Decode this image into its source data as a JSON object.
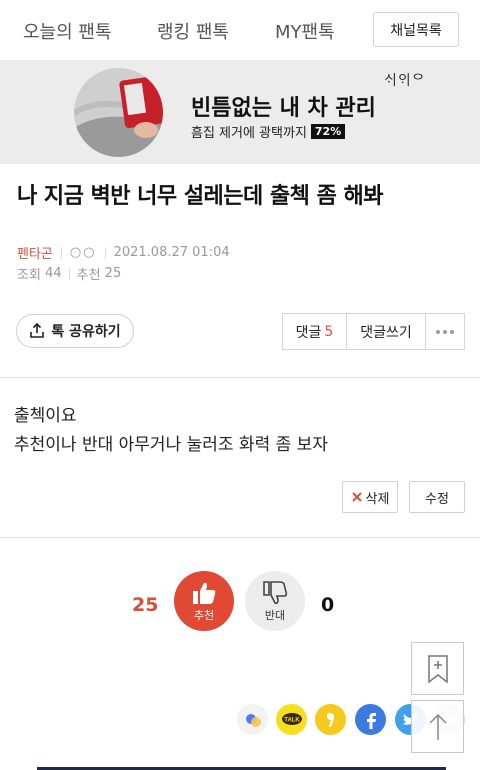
{
  "nav": {
    "tabs": [
      "오늘의 팬톡",
      "랭킹 팬톡",
      "MY팬톡"
    ],
    "channel_list_label": "채널목록"
  },
  "ad": {
    "brand": "ᄉᆡᄋᆡᄋ",
    "headline": "빈틈없는 내 차 관리",
    "sub": "흠집 제거에 광택까지",
    "badge": "72%"
  },
  "post": {
    "title": "나 지금 벽반 너무 설레는데 출첵 좀 해봐",
    "author": "펜타곤",
    "author_extra": "○○",
    "datetime": "2021.08.27 01:04",
    "views_label": "조회",
    "views": "44",
    "recommend_label": "추천",
    "recommend": "25",
    "body_lines": [
      "출첵이요",
      "추천이나 반대 아무거나 눌러조 화력 좀 보자"
    ]
  },
  "actions": {
    "share_label": "톡 공유하기",
    "comment_label": "댓글",
    "comment_count": "5",
    "write_comment_label": "댓글쓰기",
    "delete_label": "삭제",
    "edit_label": "수정"
  },
  "votes": {
    "up_count": "25",
    "up_label": "추천",
    "down_label": "반대",
    "down_count": "0"
  },
  "share_icons": [
    "dot-icon",
    "kakaotalk-icon",
    "kakaostory-icon",
    "facebook-icon",
    "twitter-icon",
    "link-icon"
  ],
  "colors": {
    "accent": "#d94f3b",
    "kakao": "#f7df1e",
    "facebook": "#3b7be0",
    "twitter": "#3fa2e8"
  }
}
